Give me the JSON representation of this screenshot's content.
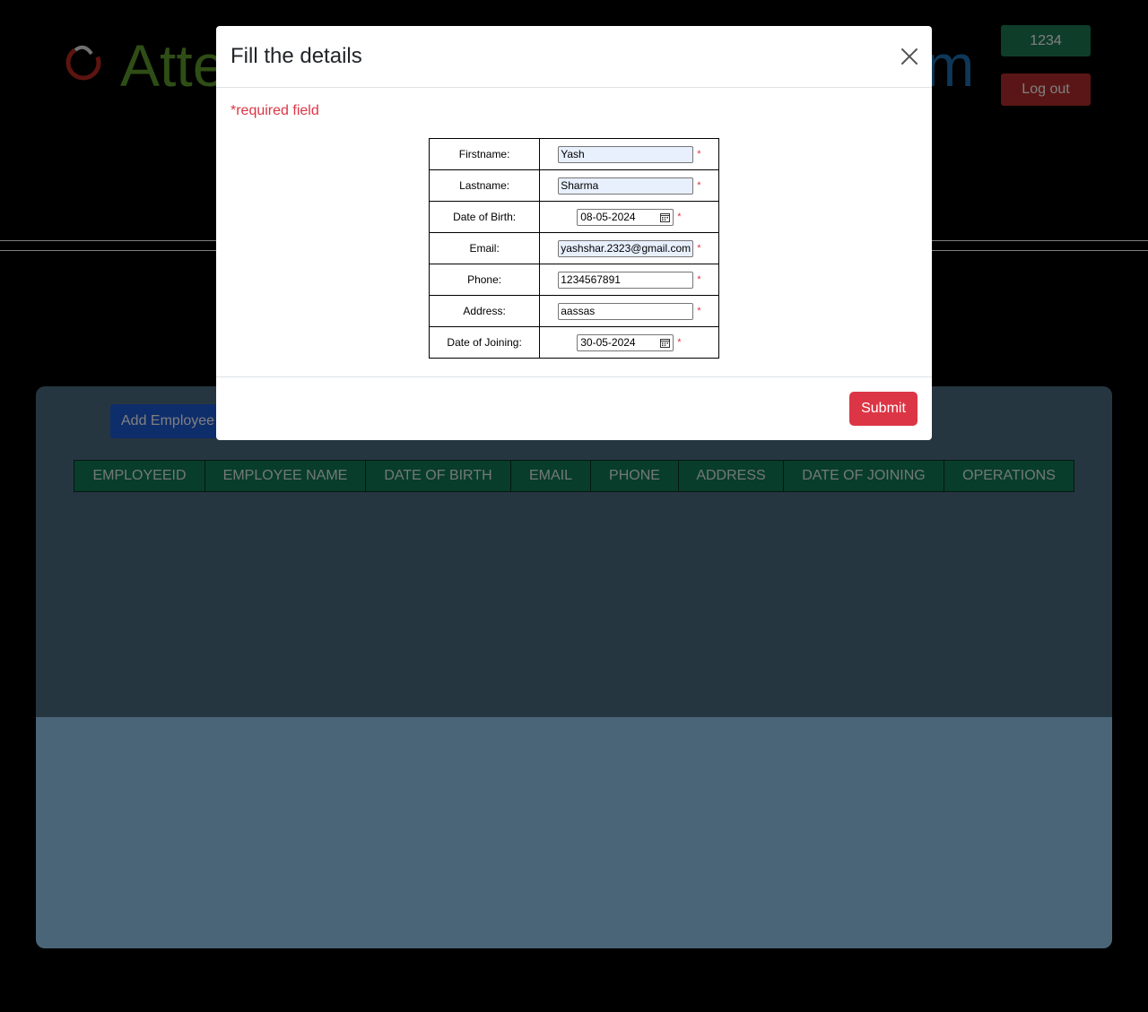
{
  "app": {
    "logo_text_start": "Atte",
    "logo_text_end": "m",
    "user_button": "1234",
    "logout_button": "Log out"
  },
  "employees": {
    "add_button": "Add Employee",
    "columns": [
      "EMPLOYEEID",
      "EMPLOYEE NAME",
      "DATE OF BIRTH",
      "EMAIL",
      "PHONE",
      "ADDRESS",
      "DATE OF JOINING",
      "OPERATIONS"
    ]
  },
  "modal": {
    "title": "Fill the details",
    "required_note": "*required field",
    "required_marker": "*",
    "submit_label": "Submit",
    "fields": {
      "firstname": {
        "label": "Firstname:",
        "value": "Yash"
      },
      "lastname": {
        "label": "Lastname:",
        "value": "Sharma"
      },
      "dob": {
        "label": "Date of Birth:",
        "value": "08-05-2024"
      },
      "email": {
        "label": "Email:",
        "value": "yashshar.2323@gmail.com"
      },
      "phone": {
        "label": "Phone:",
        "value": "1234567891"
      },
      "address": {
        "label": "Address:",
        "value": "aassas"
      },
      "doj": {
        "label": "Date of Joining:",
        "value": "30-05-2024"
      }
    }
  },
  "icons": {
    "close": "close-icon",
    "calendar": "calendar-icon",
    "logo": "logo-icon"
  }
}
